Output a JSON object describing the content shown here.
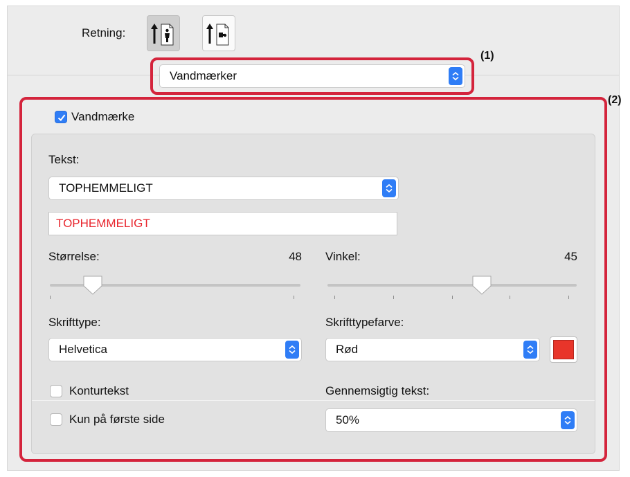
{
  "orientation": {
    "label": "Retning:",
    "options": [
      {
        "name": "portrait",
        "selected": true
      },
      {
        "name": "landscape",
        "selected": false
      }
    ]
  },
  "panel_select": {
    "value": "Vandmærker"
  },
  "callouts": {
    "one": "(1)",
    "two": "(2)"
  },
  "watermark": {
    "enabled_label": "Vandmærke",
    "enabled": true,
    "text_label": "Tekst:",
    "text_select_value": "TOPHEMMELIGT",
    "text_field_value": "TOPHEMMELIGT",
    "size_label": "Størrelse:",
    "size_value": "48",
    "size_fraction": 0.17,
    "angle_label": "Vinkel:",
    "angle_value": "45",
    "angle_fraction": 0.62,
    "font_label": "Skrifttype:",
    "font_value": "Helvetica",
    "color_label": "Skrifttypefarve:",
    "color_value": "Rød",
    "color_swatch": "#e8352a",
    "outline_label": "Konturtekst",
    "outline_checked": false,
    "first_page_label": "Kun på første side",
    "first_page_checked": false,
    "transparency_label": "Gennemsigtig tekst:",
    "transparency_value": "50%"
  },
  "colors": {
    "accent": "#2f7df6",
    "callout_frame": "#d4243c",
    "watermark_text": "#e8242c"
  },
  "icons": [
    "portrait-orientation-icon",
    "landscape-orientation-icon",
    "select-stepper-icon",
    "checkmark-icon",
    "slider-knob-icon"
  ]
}
